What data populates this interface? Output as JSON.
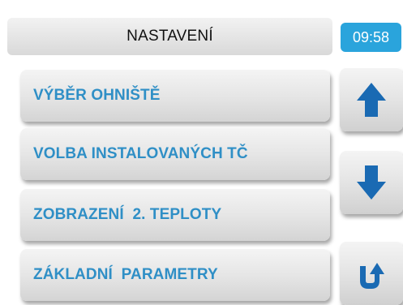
{
  "header": {
    "title": "NASTAVENÍ",
    "time": "09:58"
  },
  "menu": {
    "items": [
      {
        "label": "VÝBĚR OHNIŠTĚ"
      },
      {
        "label": "VOLBA INSTALOVANÝCH TČ"
      },
      {
        "label": "ZOBRAZENÍ  2. TEPLOTY"
      },
      {
        "label": "ZÁKLADNÍ  PARAMETRY"
      }
    ]
  },
  "navigation": {
    "up": "arrow-up-icon",
    "down": "arrow-down-icon",
    "back": "return-arrow-icon"
  },
  "colors": {
    "accent": "#2aa4dc",
    "label_text": "#2f8fc6",
    "icon": "#1a6ab3"
  }
}
